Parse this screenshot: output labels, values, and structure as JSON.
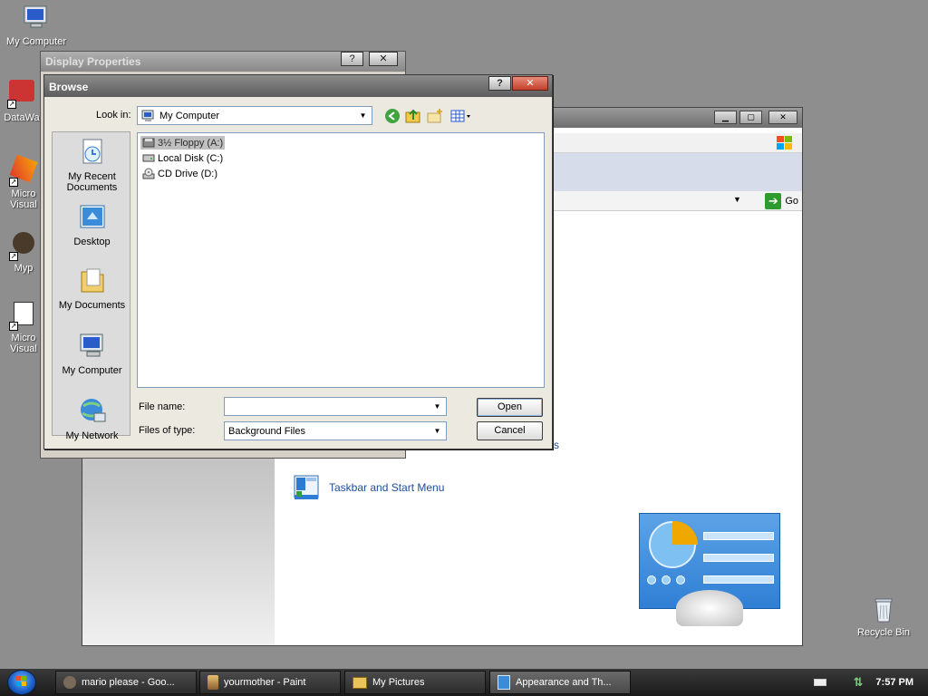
{
  "desktop": {
    "icons": [
      {
        "label": "My Computer",
        "icon": "my-computer-icon"
      },
      {
        "label": "DataWa",
        "icon": "app-shortcut-icon"
      },
      {
        "label": "Micro Visual",
        "icon": "app-shortcut-icon"
      },
      {
        "label": "Myp",
        "icon": "app-shortcut-icon"
      },
      {
        "label": "Micro Visual",
        "icon": "app-shortcut-icon"
      },
      {
        "label": "Recycle Bin",
        "icon": "recycle-bin-icon"
      }
    ]
  },
  "control_panel": {
    "address_go": "Go",
    "taskbar_link": "Taskbar and Start Menu",
    "partial_text": "s"
  },
  "display_properties": {
    "title": "Display Properties",
    "help_btn": "?",
    "close_btn": "✕"
  },
  "browse": {
    "title": "Browse",
    "help_btn": "?",
    "close_btn": "✕",
    "look_in_label": "Look in:",
    "look_in_value": "My Computer",
    "places": [
      {
        "label": "My Recent Documents",
        "icon": "recent-documents-icon"
      },
      {
        "label": "Desktop",
        "icon": "desktop-icon"
      },
      {
        "label": "My Documents",
        "icon": "my-documents-icon"
      },
      {
        "label": "My Computer",
        "icon": "my-computer-icon"
      },
      {
        "label": "My Network",
        "icon": "my-network-icon"
      }
    ],
    "files": [
      {
        "name": "3½ Floppy (A:)",
        "icon": "floppy-drive-icon",
        "selected": true
      },
      {
        "name": "Local Disk (C:)",
        "icon": "hard-disk-icon",
        "selected": false
      },
      {
        "name": "CD Drive (D:)",
        "icon": "cd-drive-icon",
        "selected": false
      }
    ],
    "file_name_label": "File name:",
    "file_name_value": "",
    "files_of_type_label": "Files of type:",
    "files_of_type_value": "Background Files",
    "open_btn": "Open",
    "cancel_btn": "Cancel"
  },
  "taskbar": {
    "tasks": [
      {
        "label": "mario please - Goo...",
        "icon": "browser-icon"
      },
      {
        "label": "yourmother - Paint",
        "icon": "paint-icon"
      },
      {
        "label": "My Pictures",
        "icon": "folder-icon"
      },
      {
        "label": "Appearance and Th...",
        "icon": "control-panel-icon",
        "active": true
      }
    ],
    "clock": "7:57 PM"
  }
}
